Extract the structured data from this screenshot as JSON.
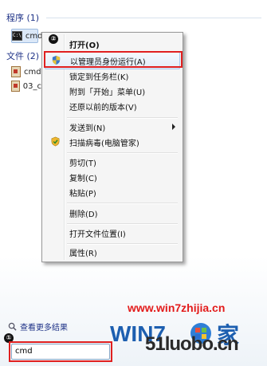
{
  "groups": {
    "programs": {
      "header": "程序 (1)"
    },
    "files": {
      "header": "文件 (2)"
    }
  },
  "results": {
    "program_cmd": "cmd",
    "file_1": "cmd",
    "file_2": "03_c"
  },
  "context_menu": {
    "items": [
      {
        "label": "打开(O)",
        "bold": true,
        "icon": ""
      },
      {
        "label": "以管理员身份运行(A)",
        "icon": "uac-shield-icon",
        "highlighted": true
      },
      {
        "label": "锁定到任务栏(K)",
        "icon": ""
      },
      {
        "label": "附到「开始」菜单(U)",
        "icon": ""
      },
      {
        "label": "还原以前的版本(V)",
        "icon": ""
      },
      {
        "label": "发送到(N)",
        "submenu": true,
        "icon": ""
      },
      {
        "label": "扫描病毒(电脑管家)",
        "icon": "antivirus-shield-icon"
      },
      {
        "label": "剪切(T)",
        "icon": ""
      },
      {
        "label": "复制(C)",
        "icon": ""
      },
      {
        "label": "粘贴(P)",
        "icon": ""
      },
      {
        "label": "删除(D)",
        "icon": ""
      },
      {
        "label": "打开文件位置(I)",
        "icon": ""
      },
      {
        "label": "属性(R)",
        "icon": ""
      }
    ]
  },
  "annotations": {
    "step_1": "①",
    "step_2": "②",
    "box_color": "#e02020"
  },
  "see_more": "查看更多结果",
  "search": {
    "value": "cmd"
  },
  "watermark": {
    "url": "www.win7zhijia.cn",
    "site": "51luobo.cn"
  }
}
